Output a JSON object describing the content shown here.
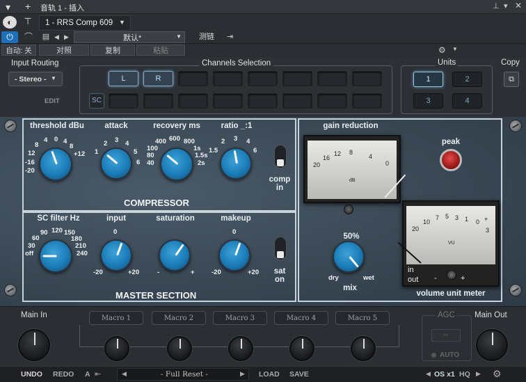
{
  "titlebar": {
    "title": "音轨 1 - 插入"
  },
  "toolbar": {
    "preset_name": "1 - RRS Comp 609",
    "default_label": "默认*",
    "compare_label": "测链",
    "autooff_label": "自动: 关",
    "compare_btn": "对照",
    "copy_btn": "复制",
    "paste_btn": "粘贴"
  },
  "routing": {
    "input_routing_label": "Input Routing",
    "input_routing_value": "- Stereo -",
    "edit_label": "EDIT",
    "channels_label": "Channels Selection",
    "channel_l": "L",
    "channel_r": "R",
    "sc_label": "SC",
    "units_label": "Units",
    "units": [
      "1",
      "2",
      "3",
      "4"
    ],
    "copy_label": "Copy"
  },
  "compressor": {
    "section_label": "COMPRESSOR",
    "threshold": {
      "label": "threshold dBu",
      "ticks": [
        "-20",
        "-16",
        "12",
        "8",
        "4",
        "0",
        "4",
        "8",
        "+12"
      ]
    },
    "attack": {
      "label": "attack",
      "ticks": [
        "1",
        "2",
        "3",
        "4",
        "5",
        "6"
      ]
    },
    "recovery": {
      "label": "recovery ms",
      "ticks": [
        "40",
        "80",
        "100",
        "400",
        "600",
        "800",
        "1s",
        "1.5s",
        "2s"
      ]
    },
    "ratio": {
      "label": "ratio _:1",
      "ticks": [
        "1.5",
        "2",
        "3",
        "4",
        "6"
      ]
    },
    "comp_in_label": "comp\nin"
  },
  "master": {
    "section_label": "MASTER SECTION",
    "sc_filter": {
      "label": "SC filter Hz",
      "ticks": [
        "off",
        "30",
        "60",
        "90",
        "120",
        "150",
        "180",
        "210",
        "240"
      ]
    },
    "input": {
      "label": "input",
      "ticks": [
        "-20",
        "0",
        "+20"
      ]
    },
    "saturation": {
      "label": "saturation",
      "ticks": [
        "-",
        "+"
      ]
    },
    "makeup": {
      "label": "makeup",
      "ticks": [
        "-20",
        "0",
        "+20"
      ]
    },
    "sat_on_label": "sat\non"
  },
  "gr_meter": {
    "label": "gain reduction",
    "scale": [
      "20",
      "16",
      "12",
      "8",
      "4",
      "0"
    ],
    "unit": "dB"
  },
  "peak_label": "peak",
  "mix": {
    "value_label": "50%",
    "dry": "dry",
    "wet": "wet",
    "label": "mix"
  },
  "vu_meter": {
    "label": "volume unit meter",
    "scale": [
      "20",
      "10",
      "7",
      "5",
      "3",
      "1",
      "0",
      "+",
      "3"
    ],
    "unit": "VU",
    "in_label": "in",
    "out_label": "out",
    "minus": "-",
    "plus": "+"
  },
  "macros": {
    "main_in": "Main In",
    "main_out": "Main Out",
    "agc": "AGC",
    "agc_value": "--",
    "auto": "AUTO",
    "buttons": [
      "Macro 1",
      "Macro 2",
      "Macro 3",
      "Macro 4",
      "Macro 5"
    ]
  },
  "footer": {
    "undo": "UNDO",
    "redo": "REDO",
    "a_label": "A",
    "preset": "- Full Reset -",
    "load": "LOAD",
    "save": "SAVE",
    "os": "OS x1",
    "hq": "HQ"
  }
}
